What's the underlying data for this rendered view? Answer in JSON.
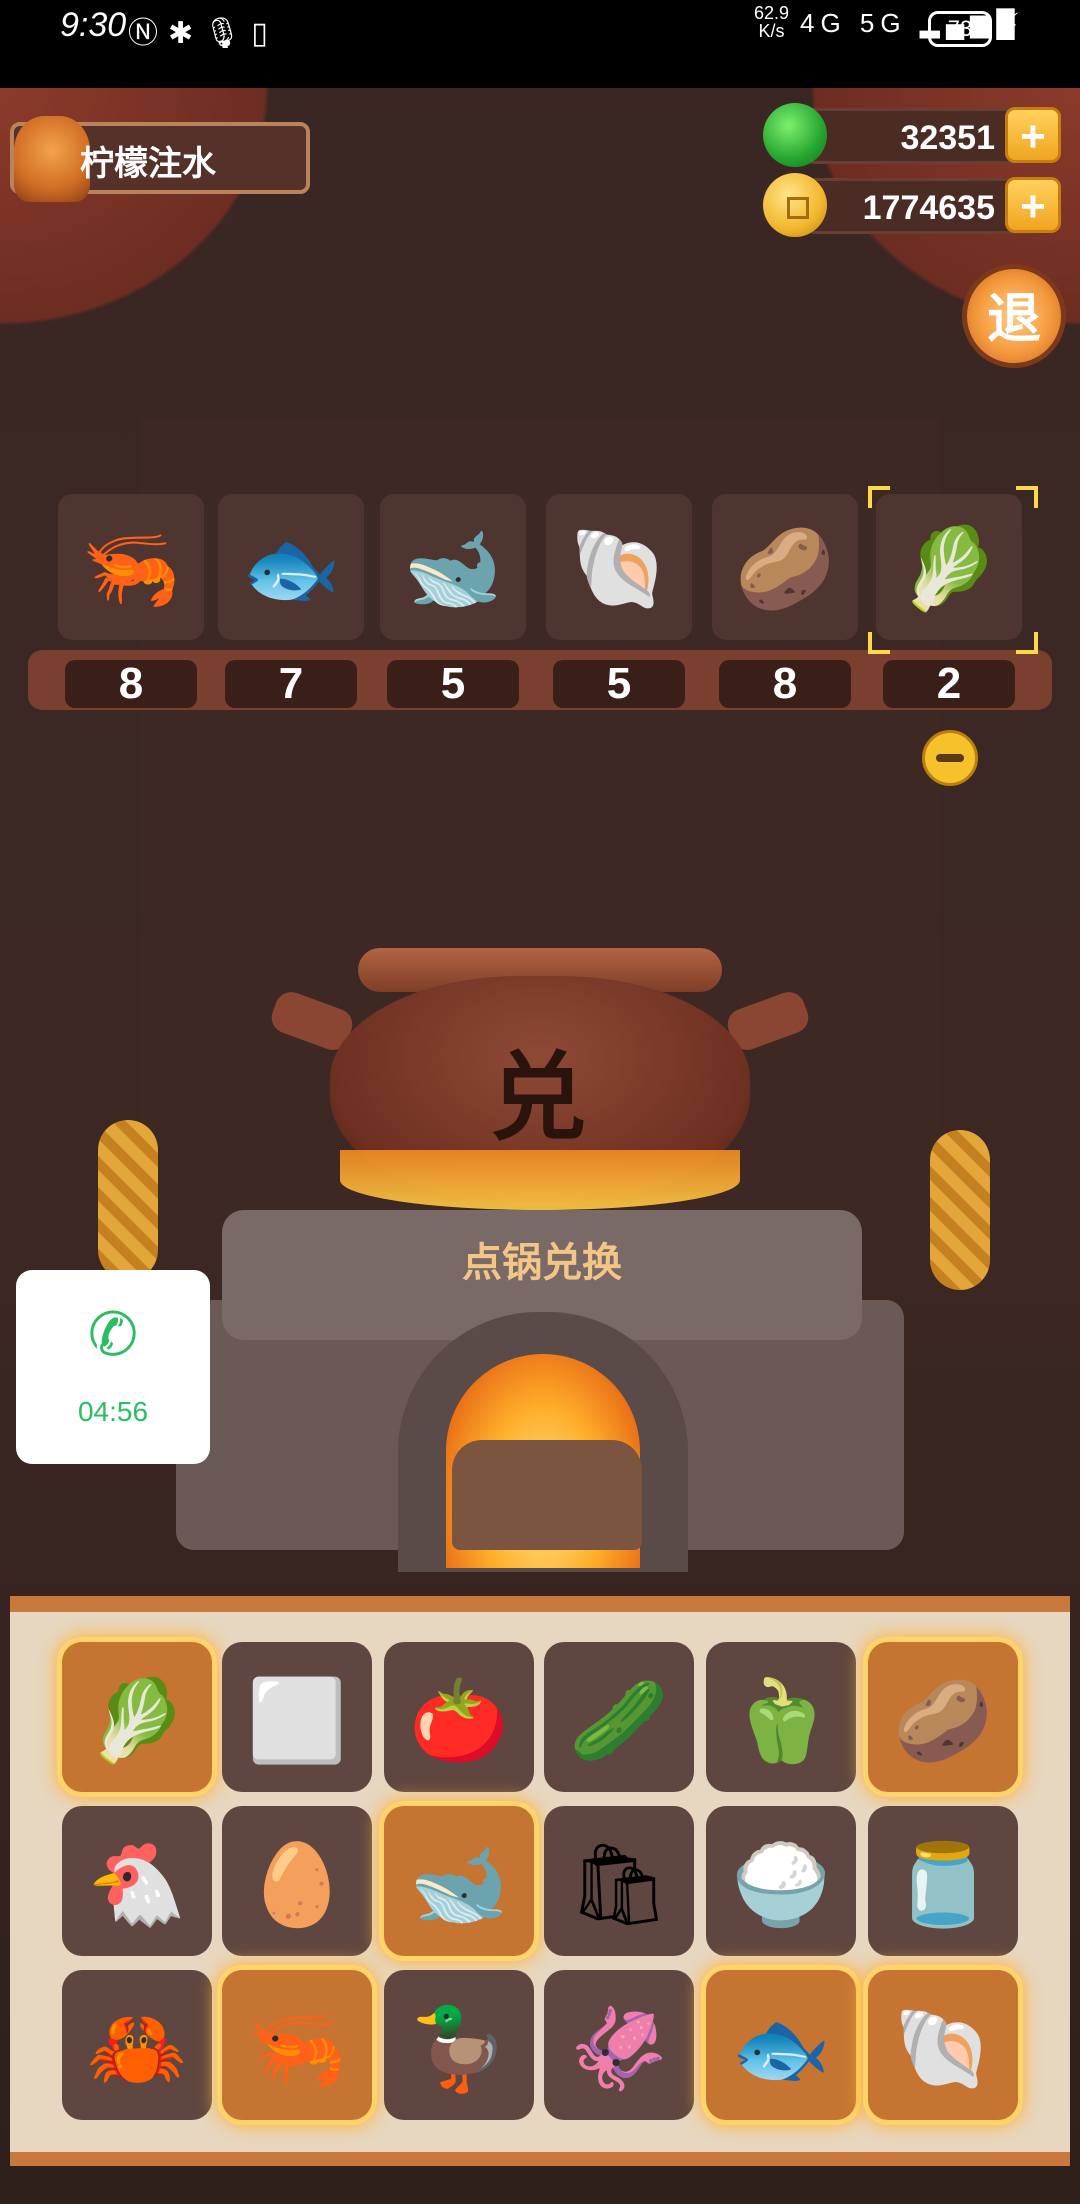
{
  "status_bar": {
    "time": "9:30",
    "left_icons": [
      "nfc-icon",
      "bluetooth-icon",
      "mic-icon",
      "vibrate-icon"
    ],
    "net_speed": "62.9",
    "net_unit": "K/s",
    "signal": "4G 5G",
    "battery": "73"
  },
  "player": {
    "name": "柠檬注水"
  },
  "currency": [
    {
      "name": "jade",
      "value": "32351"
    },
    {
      "name": "coin",
      "value": "1774635"
    }
  ],
  "exit_label": "退",
  "selected": [
    {
      "item": "shrimp",
      "glyph": "🦐",
      "count": "8"
    },
    {
      "item": "red-fish",
      "glyph": "🐟",
      "count": "7"
    },
    {
      "item": "blue-fish",
      "glyph": "🐋",
      "count": "5"
    },
    {
      "item": "clam",
      "glyph": "🐚",
      "count": "5"
    },
    {
      "item": "potato",
      "glyph": "🥔",
      "count": "8"
    },
    {
      "item": "green-onion",
      "glyph": "🥬",
      "count": "2"
    }
  ],
  "pot": {
    "char": "兑",
    "label": "点锅兑换"
  },
  "call": {
    "timer": "04:56"
  },
  "ingredients": [
    {
      "item": "green-onion",
      "glyph": "🥬",
      "selected": true
    },
    {
      "item": "tofu",
      "glyph": "⬜",
      "selected": false
    },
    {
      "item": "tomato",
      "glyph": "🍅",
      "selected": false
    },
    {
      "item": "cucumber",
      "glyph": "🥒",
      "selected": false
    },
    {
      "item": "green-pepper",
      "glyph": "🫑",
      "selected": false
    },
    {
      "item": "potato",
      "glyph": "🥔",
      "selected": true
    },
    {
      "item": "chicken",
      "glyph": "🐔",
      "selected": false
    },
    {
      "item": "egg",
      "glyph": "🥚",
      "selected": false
    },
    {
      "item": "blue-fish",
      "glyph": "🐋",
      "selected": true
    },
    {
      "item": "flour-sack",
      "glyph": "🛍",
      "selected": false
    },
    {
      "item": "rice-bowl",
      "glyph": "🍚",
      "selected": false
    },
    {
      "item": "jar",
      "glyph": "🫙",
      "selected": false
    },
    {
      "item": "crab",
      "glyph": "🦀",
      "selected": false
    },
    {
      "item": "shrimp",
      "glyph": "🦐",
      "selected": true
    },
    {
      "item": "duck",
      "glyph": "🦆",
      "selected": false
    },
    {
      "item": "squid",
      "glyph": "🦑",
      "selected": false
    },
    {
      "item": "red-fish",
      "glyph": "🐟",
      "selected": true
    },
    {
      "item": "clam",
      "glyph": "🐚",
      "selected": true
    }
  ]
}
